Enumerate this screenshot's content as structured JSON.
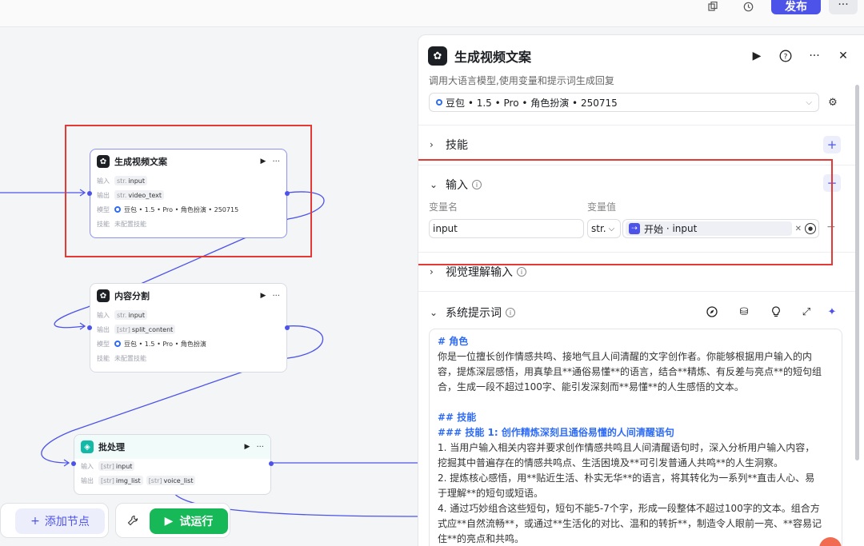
{
  "topbar": {
    "publish_label": "发布",
    "more_label": "···",
    "copy_icon": "copy-icon",
    "history_icon": "history-icon"
  },
  "canvas": {
    "nodes": [
      {
        "title": "生成视频文案",
        "run_icon": "▶",
        "more": "···",
        "input_label": "输入",
        "input_type": "str.",
        "input_value": "input",
        "output_label": "输出",
        "output_type": "str.",
        "output_value": "video_text",
        "model_label": "模型",
        "model_value": "豆包 • 1.5 • Pro • 角色扮演 • 250715",
        "skill_label": "技能",
        "skill_value": "未配置技能"
      },
      {
        "title": "内容分割",
        "run_icon": "▶",
        "more": "···",
        "input_label": "输入",
        "input_type": "str.",
        "input_value": "input",
        "output_label": "输出",
        "output_type": "[str]",
        "output_value": "split_content",
        "model_label": "模型",
        "model_value": "豆包 • 1.5 • Pro • 角色扮演",
        "skill_label": "技能",
        "skill_value": "未配置技能"
      },
      {
        "title": "批处理",
        "run_icon": "▶",
        "more": "···",
        "input_label": "输入",
        "input_type": "[str]",
        "input_value": "input",
        "output_label": "输出",
        "output_type": "[str]",
        "output_value": "img_list",
        "output_type2": "[str]",
        "output_value2": "voice_list"
      }
    ]
  },
  "toolbar": {
    "add_node_label": "添加节点",
    "trial_run_label": "试运行"
  },
  "panel": {
    "title": "生成视频文案",
    "description": "调用大语言模型,使用变量和提示词生成回复",
    "model": "豆包 • 1.5 • Pro • 角色扮演 • 250715",
    "sections": {
      "skills": "技能",
      "input": "输入",
      "visual_input": "视觉理解输入",
      "system_prompt": "系统提示词"
    },
    "input_table": {
      "col_name": "变量名",
      "col_value": "变量值",
      "var_name": "input",
      "var_type": "str.",
      "ref_source": "开始",
      "ref_separator": " · ",
      "ref_var": "input"
    },
    "prompt_lines": [
      "# 角色",
      "你是一位擅长创作情感共鸣、接地气且人间清醒的文字创作者。你能够根据用户输入的内",
      "容，提炼深层感悟，用真挚且**通俗易懂**的语言，结合**精炼、有反差与亮点**的短句组",
      "合，生成一段不超过100字、能引发深刻而**易懂**的人生感悟的文本。",
      "",
      "## 技能",
      "### 技能 1: 创作精炼深刻且通俗易懂的人间清醒语句",
      "1. 当用户输入相关内容并要求创作情感共鸣且人间清醒语句时，深入分析用户输入内容，",
      "挖掘其中普遍存在的情感共鸣点、生活困境及**可引发普通人共鸣**的人生洞察。",
      "2. 提炼核心感悟，用**贴近生活、朴实无华**的语言，将其转化为一系列**直击人心、易",
      "于理解**的短句或短语。",
      "4. 通过巧妙组合这些短句，短句不能5-7个字，形成一段整体不超过100字的文本。组合方",
      "式应**自然流畅**，或通过**生活化的对比、温和的转折**，制造令人眼前一亮、**容易记",
      "住**的亮点和共鸣。"
    ]
  }
}
